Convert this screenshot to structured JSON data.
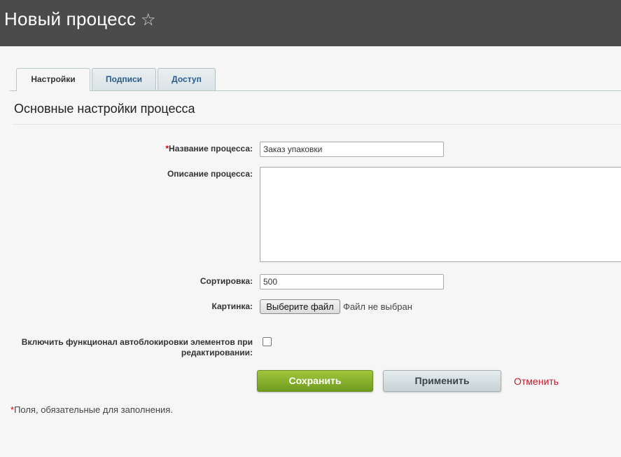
{
  "header": {
    "title": "Новый процесс",
    "star_icon": "☆"
  },
  "tabs": [
    {
      "label": "Настройки",
      "active": true
    },
    {
      "label": "Подписи",
      "active": false
    },
    {
      "label": "Доступ",
      "active": false
    }
  ],
  "section": {
    "title": "Основные настройки процесса"
  },
  "form": {
    "required_mark": "*",
    "name_label": "Название процесса:",
    "name_value": "Заказ упаковки",
    "description_label": "Описание процесса:",
    "description_value": "",
    "sort_label": "Сортировка:",
    "sort_value": "500",
    "image_label": "Картинка:",
    "file_button_label": "Выберите файл",
    "file_status": "Файл не выбран",
    "autolock_label_line1": "Включить функционал автоблокировки элементов при",
    "autolock_label_line2": "редактировании:",
    "autolock_checked": false
  },
  "actions": {
    "save_label": "Сохранить",
    "apply_label": "Применить",
    "cancel_label": "Отменить"
  },
  "footnote": {
    "mark": "*",
    "text": "Поля, обязательные для заполнения."
  },
  "colors": {
    "header_bg": "#4b4b4b",
    "save_green": "#8ab42e",
    "cancel_red": "#c0192c",
    "required_red": "#dd0000"
  }
}
